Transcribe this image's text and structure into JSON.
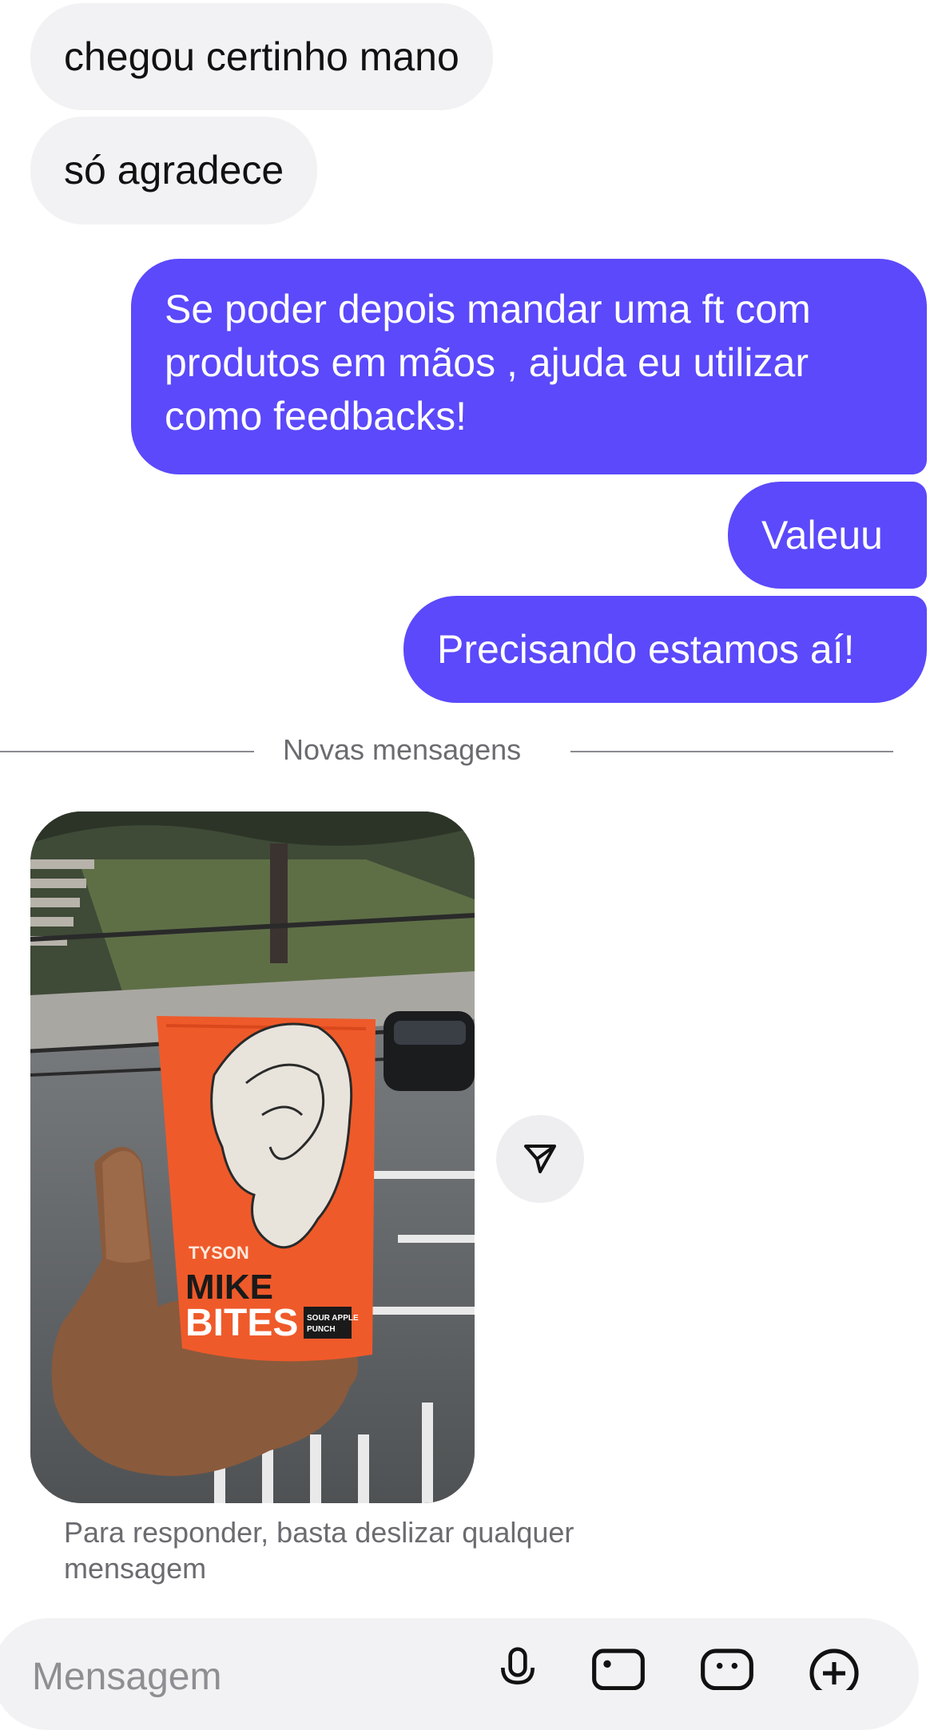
{
  "messages": [
    {
      "text": "chegou certinho mano"
    },
    {
      "text": "só agradece"
    },
    {
      "text": "Se poder depois mandar uma ft com produtos em mãos , ajuda eu utilizar como feedbacks!"
    },
    {
      "text": "Valeuu"
    },
    {
      "text": "Precisando estamos aí!"
    }
  ],
  "divider": {
    "label": "Novas mensagens"
  },
  "photo": {
    "subject": "hand holding snack bag",
    "bag_brand": "TYSON",
    "bag_title_1": "MIKE",
    "bag_title_2": "BITES",
    "bag_flavor": "SOUR APPLE PUNCH"
  },
  "hint": {
    "text": "Para responder, basta deslizar qualquer mensagem"
  },
  "composer": {
    "placeholder": "Mensagem",
    "icons": [
      "microphone-icon",
      "photo-icon",
      "sticker-icon",
      "add-icon"
    ]
  },
  "colors": {
    "outgoing": "#5b49fb",
    "incoming": "#f2f2f4"
  }
}
